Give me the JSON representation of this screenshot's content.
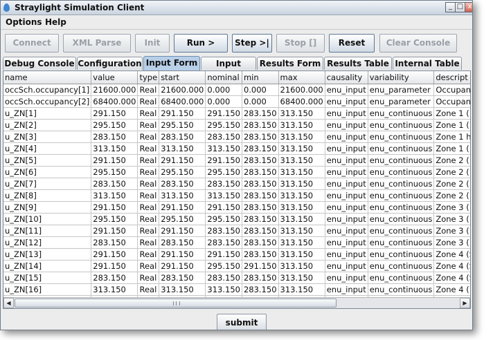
{
  "window": {
    "title": "Straylight Simulation Client"
  },
  "menu": [
    "Options",
    "Help"
  ],
  "toolbar": [
    {
      "label": "Connect",
      "enabled": false
    },
    {
      "label": "XML Parse",
      "enabled": false
    },
    {
      "label": "Init",
      "enabled": false
    },
    {
      "label": "Run >",
      "enabled": true
    },
    {
      "label": "Step >|",
      "enabled": true
    },
    {
      "label": "Stop []",
      "enabled": false
    },
    {
      "label": "Reset",
      "enabled": true
    },
    {
      "label": "Clear Console",
      "enabled": false
    }
  ],
  "tabs": [
    "Debug Console",
    "Configuration",
    "Input Form",
    "Input Detail",
    "Results Form",
    "Results Table",
    "Internal Table"
  ],
  "active_tab": "Input Form",
  "table": {
    "columns": [
      "name",
      "value",
      "type",
      "start",
      "nominal",
      "min",
      "max",
      "causality",
      "variability",
      "descript"
    ],
    "rows": [
      [
        "occSch.occupancy[1]",
        "21600.000",
        "Real",
        "21600.000",
        "0.000",
        "0.000",
        "21600.000",
        "enu_input",
        "enu_parameter",
        "Occupan"
      ],
      [
        "occSch.occupancy[2]",
        "68400.000",
        "Real",
        "68400.000",
        "0.000",
        "0.000",
        "68400.000",
        "enu_input",
        "enu_parameter",
        "Occupan"
      ],
      [
        "u_ZN[1]",
        "291.150",
        "Real",
        "291.150",
        "291.150",
        "283.150",
        "313.150",
        "enu_input",
        "enu_continuous",
        "Zone 1 ("
      ],
      [
        "u_ZN[2]",
        "295.150",
        "Real",
        "295.150",
        "295.150",
        "283.150",
        "313.150",
        "enu_input",
        "enu_continuous",
        "Zone 1 ("
      ],
      [
        "u_ZN[3]",
        "283.150",
        "Real",
        "283.150",
        "283.150",
        "283.150",
        "313.150",
        "enu_input",
        "enu_continuous",
        "Zone 1 h"
      ],
      [
        "u_ZN[4]",
        "313.150",
        "Real",
        "313.150",
        "313.150",
        "283.150",
        "313.150",
        "enu_input",
        "enu_continuous",
        "Zone 1 ("
      ],
      [
        "u_ZN[5]",
        "291.150",
        "Real",
        "291.150",
        "291.150",
        "283.150",
        "313.150",
        "enu_input",
        "enu_continuous",
        "Zone 2 ("
      ],
      [
        "u_ZN[6]",
        "295.150",
        "Real",
        "295.150",
        "295.150",
        "283.150",
        "313.150",
        "enu_input",
        "enu_continuous",
        "Zone 2 ("
      ],
      [
        "u_ZN[7]",
        "283.150",
        "Real",
        "283.150",
        "283.150",
        "283.150",
        "313.150",
        "enu_input",
        "enu_continuous",
        "Zone 2 ("
      ],
      [
        "u_ZN[8]",
        "313.150",
        "Real",
        "313.150",
        "313.150",
        "283.150",
        "313.150",
        "enu_input",
        "enu_continuous",
        "Zone 2 ("
      ],
      [
        "u_ZN[9]",
        "291.150",
        "Real",
        "291.150",
        "291.150",
        "283.150",
        "313.150",
        "enu_input",
        "enu_continuous",
        "Zone 3 ("
      ],
      [
        "u_ZN[10]",
        "295.150",
        "Real",
        "295.150",
        "295.150",
        "283.150",
        "313.150",
        "enu_input",
        "enu_continuous",
        "Zone 3 ("
      ],
      [
        "u_ZN[11]",
        "291.150",
        "Real",
        "291.150",
        "283.150",
        "283.150",
        "313.150",
        "enu_input",
        "enu_continuous",
        "Zone 3 ("
      ],
      [
        "u_ZN[12]",
        "283.150",
        "Real",
        "283.150",
        "283.150",
        "283.150",
        "313.150",
        "enu_input",
        "enu_continuous",
        "Zone 3 ("
      ],
      [
        "u_ZN[13]",
        "291.150",
        "Real",
        "291.150",
        "291.150",
        "283.150",
        "313.150",
        "enu_input",
        "enu_continuous",
        "Zone 4 (S"
      ],
      [
        "u_ZN[14]",
        "291.150",
        "Real",
        "291.150",
        "295.150",
        "291.150",
        "313.150",
        "enu_input",
        "enu_continuous",
        "Zone 4 (S"
      ],
      [
        "u_ZN[15]",
        "283.150",
        "Real",
        "283.150",
        "283.150",
        "283.150",
        "313.150",
        "enu_input",
        "enu_continuous",
        "Zone 4 (S"
      ],
      [
        "u_ZN[16]",
        "313.150",
        "Real",
        "313.150",
        "313.150",
        "283.150",
        "313.150",
        "enu_input",
        "enu_continuous",
        "Zone 4 ("
      ],
      [
        "u_ZN[17]",
        "291.150",
        "Real",
        "291.150",
        "291.150",
        "283.150",
        "313.150",
        "enu_input",
        "enu_continuous",
        "Zone 5 ("
      ]
    ]
  },
  "submit_label": "submit",
  "icons": {
    "app": "water-drop-icon",
    "minimize": "_",
    "maximize": "□",
    "close": "x",
    "scroll_left": "◀",
    "scroll_right": "▶"
  },
  "colors": {
    "active_tab": "#b8cfe8",
    "enabled_button_border": "#5c7693",
    "disabled_text": "#9ba0a6"
  }
}
